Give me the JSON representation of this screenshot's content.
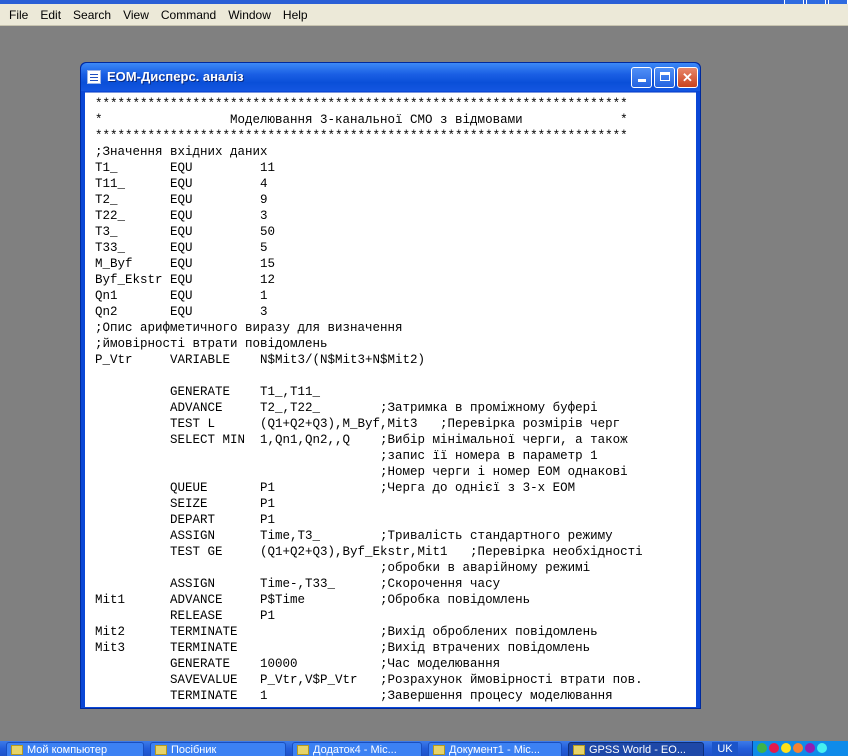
{
  "menu": [
    "File",
    "Edit",
    "Search",
    "View",
    "Command",
    "Window",
    "Help"
  ],
  "window": {
    "title": "ЕОМ-Дисперс. аналіз",
    "code_lines": [
      "***********************************************************************",
      "*                 Моделювання 3-канальної СМО з відмовами             *",
      "***********************************************************************",
      ";Значення вхідних даних",
      "T1_       EQU         11",
      "T11_      EQU         4",
      "T2_       EQU         9",
      "T22_      EQU         3",
      "T3_       EQU         50",
      "T33_      EQU         5",
      "M_Byf     EQU         15",
      "Byf_Ekstr EQU         12",
      "Qn1       EQU         1",
      "Qn2       EQU         3",
      ";Опис арифметичного виразу для визначення",
      ";ймовірності втрати повідомлень",
      "P_Vtr     VARIABLE    N$Mit3/(N$Mit3+N$Mit2)",
      "",
      "          GENERATE    T1_,T11_",
      "          ADVANCE     T2_,T22_        ;Затримка в проміжному буфері",
      "          TEST L      (Q1+Q2+Q3),M_Byf,Mit3   ;Перевірка розмірів черг",
      "          SELECT MIN  1,Qn1,Qn2,,Q    ;Вибір мінімальної черги, а також",
      "                                      ;запис її номера в параметр 1",
      "                                      ;Номер черги і номер ЕОМ однакові",
      "          QUEUE       P1              ;Черга до однієї з 3-х ЕОМ",
      "          SEIZE       P1",
      "          DEPART      P1",
      "          ASSIGN      Time,T3_        ;Тривалість стандартного режиму",
      "          TEST GE     (Q1+Q2+Q3),Byf_Ekstr,Mit1   ;Перевірка необхідності",
      "                                      ;обробки в аварійному режимі",
      "          ASSIGN      Time-,T33_      ;Скорочення часу",
      "Mit1      ADVANCE     P$Time          ;Обробка повідомлень",
      "          RELEASE     P1",
      "Mit2      TERMINATE                   ;Вихід оброблених повідомлень",
      "Mit3      TERMINATE                   ;Вихід втрачених повідомлень",
      "          GENERATE    10000           ;Час моделювання",
      "          SAVEVALUE   P_Vtr,V$P_Vtr   ;Розрахунок ймовірності втрати пов.",
      "          TERMINATE   1               ;Завершення процесу моделювання"
    ]
  },
  "taskbar": {
    "tasks": [
      "Мой компьютер",
      "Посібник",
      "Додаток4 - Mic...",
      "Документ1 - Mic...",
      "GPSS World - EO..."
    ],
    "active_index": 4,
    "language": "UK"
  },
  "colors": {
    "desktop_bg": "#808080",
    "title_blue": "#0a4fd8",
    "close_red": "#c9421e",
    "menu_bg": "#ece9d8"
  }
}
